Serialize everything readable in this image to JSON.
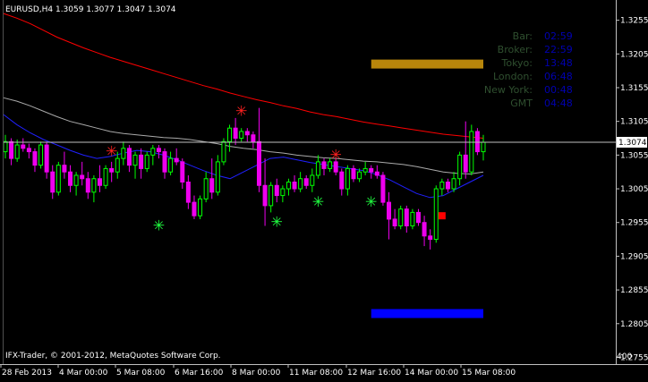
{
  "symbol_header": "EURUSD,H4  1.3059 1.3077 1.3047 1.3074",
  "copyright": "IFX-Trader, © 2001-2012, MetaQuotes Software Corp.",
  "corner_label": "400",
  "info_panel": {
    "rows": [
      {
        "label": "Bar:",
        "value": "02:59"
      },
      {
        "label": "Broker:",
        "value": "22:59"
      },
      {
        "label": "Tokyo:",
        "value": "13:48"
      },
      {
        "label": "London:",
        "value": "06:48"
      },
      {
        "label": "New York:",
        "value": "00:48"
      },
      {
        "label": "GMT",
        "value": "04:48"
      }
    ]
  },
  "colors": {
    "background": "#000000",
    "axis": "#c0c0c0",
    "text": "#ffffff",
    "bull": "#00ff00",
    "bear": "#ee00ee",
    "ma_red": "#ff0000",
    "ma_gray": "#aaaaaa",
    "ma_blue": "#2020ff",
    "panel_label": "#2f4f2f",
    "panel_value": "#0000b0",
    "gold_bar": "#b8860b",
    "blue_bar": "#0000ff",
    "star_red": "#ff2020",
    "star_green": "#20ff40",
    "marker_red": "#ff0000"
  },
  "chart_data": {
    "type": "candlestick",
    "current_price": "1.3074",
    "y_ticks": [
      "1.3255",
      "1.3205",
      "1.3155",
      "1.3105",
      "1.3055",
      "1.3005",
      "1.2955",
      "1.2905",
      "1.2855",
      "1.2805",
      "1.2755"
    ],
    "x_ticks": [
      "28 Feb 2013",
      "4 Mar 00:00",
      "5 Mar 08:00",
      "6 Mar 16:00",
      "8 Mar 00:00",
      "11 Mar 08:00",
      "12 Mar 16:00",
      "14 Mar 00:00",
      "15 Mar 08:00"
    ],
    "ylim": [
      1.2745,
      1.3285
    ],
    "candles": [
      [
        1.306,
        1.3085,
        1.305,
        1.3075
      ],
      [
        1.3075,
        1.308,
        1.304,
        1.305
      ],
      [
        1.305,
        1.3078,
        1.3045,
        1.307
      ],
      [
        1.307,
        1.308,
        1.306,
        1.3065
      ],
      [
        1.3065,
        1.3072,
        1.305,
        1.306
      ],
      [
        1.306,
        1.3065,
        1.303,
        1.304
      ],
      [
        1.304,
        1.3075,
        1.3035,
        1.307
      ],
      [
        1.307,
        1.3075,
        1.302,
        1.303
      ],
      [
        1.303,
        1.304,
        1.299,
        1.3
      ],
      [
        1.3,
        1.3045,
        1.2995,
        1.304
      ],
      [
        1.304,
        1.306,
        1.302,
        1.303
      ],
      [
        1.303,
        1.304,
        1.3,
        1.301
      ],
      [
        1.301,
        1.303,
        1.2995,
        1.3025
      ],
      [
        1.3025,
        1.3045,
        1.301,
        1.302
      ],
      [
        1.302,
        1.303,
        1.299,
        1.3
      ],
      [
        1.3,
        1.3025,
        1.2985,
        1.302
      ],
      [
        1.302,
        1.304,
        1.3,
        1.301
      ],
      [
        1.301,
        1.304,
        1.3005,
        1.3035
      ],
      [
        1.3035,
        1.3045,
        1.3015,
        1.303
      ],
      [
        1.303,
        1.306,
        1.302,
        1.305
      ],
      [
        1.305,
        1.3075,
        1.304,
        1.3065
      ],
      [
        1.3065,
        1.307,
        1.303,
        1.304
      ],
      [
        1.304,
        1.306,
        1.302,
        1.3055
      ],
      [
        1.3055,
        1.3065,
        1.302,
        1.3035
      ],
      [
        1.3035,
        1.306,
        1.303,
        1.3055
      ],
      [
        1.3055,
        1.307,
        1.304,
        1.3065
      ],
      [
        1.3065,
        1.307,
        1.305,
        1.306
      ],
      [
        1.306,
        1.3065,
        1.302,
        1.303
      ],
      [
        1.303,
        1.306,
        1.3025,
        1.305
      ],
      [
        1.305,
        1.3065,
        1.304,
        1.3045
      ],
      [
        1.3045,
        1.305,
        1.3005,
        1.3015
      ],
      [
        1.3015,
        1.3025,
        1.2975,
        1.2985
      ],
      [
        1.2985,
        1.2995,
        1.296,
        1.2965
      ],
      [
        1.2965,
        1.2995,
        1.296,
        1.299
      ],
      [
        1.299,
        1.303,
        1.2985,
        1.302
      ],
      [
        1.302,
        1.305,
        1.299,
        1.3
      ],
      [
        1.3,
        1.3055,
        1.2995,
        1.3045
      ],
      [
        1.3045,
        1.308,
        1.304,
        1.3075
      ],
      [
        1.3075,
        1.31,
        1.306,
        1.3095
      ],
      [
        1.3095,
        1.311,
        1.307,
        1.308
      ],
      [
        1.308,
        1.3095,
        1.3075,
        1.309
      ],
      [
        1.309,
        1.3095,
        1.3075,
        1.3085
      ],
      [
        1.3085,
        1.309,
        1.3065,
        1.3075
      ],
      [
        1.3075,
        1.3125,
        1.3,
        1.301
      ],
      [
        1.301,
        1.305,
        1.295,
        1.298
      ],
      [
        1.298,
        1.3015,
        1.297,
        1.301
      ],
      [
        1.301,
        1.302,
        1.2985,
        1.2995
      ],
      [
        1.2995,
        1.301,
        1.2985,
        1.3005
      ],
      [
        1.3005,
        1.302,
        1.2995,
        1.3015
      ],
      [
        1.3015,
        1.3025,
        1.3,
        1.3005
      ],
      [
        1.3005,
        1.303,
        1.3,
        1.302
      ],
      [
        1.302,
        1.3025,
        1.3005,
        1.301
      ],
      [
        1.301,
        1.3035,
        1.3,
        1.3025
      ],
      [
        1.3025,
        1.3055,
        1.302,
        1.3045
      ],
      [
        1.3045,
        1.305,
        1.3025,
        1.3035
      ],
      [
        1.3035,
        1.305,
        1.303,
        1.3045
      ],
      [
        1.3045,
        1.305,
        1.3025,
        1.303
      ],
      [
        1.303,
        1.3035,
        1.2995,
        1.3005
      ],
      [
        1.3005,
        1.304,
        1.2995,
        1.3035
      ],
      [
        1.3035,
        1.304,
        1.3015,
        1.302
      ],
      [
        1.302,
        1.3035,
        1.3015,
        1.303
      ],
      [
        1.303,
        1.3045,
        1.3025,
        1.3035
      ],
      [
        1.3035,
        1.304,
        1.302,
        1.303
      ],
      [
        1.303,
        1.304,
        1.302,
        1.3025
      ],
      [
        1.3025,
        1.303,
        1.298,
        1.2985
      ],
      [
        1.2985,
        1.3,
        1.293,
        1.296
      ],
      [
        1.296,
        1.2975,
        1.2945,
        1.295
      ],
      [
        1.295,
        1.298,
        1.2945,
        1.2975
      ],
      [
        1.2975,
        1.298,
        1.294,
        1.295
      ],
      [
        1.295,
        1.2975,
        1.2945,
        1.297
      ],
      [
        1.297,
        1.2975,
        1.295,
        1.2955
      ],
      [
        1.2955,
        1.2965,
        1.292,
        1.2935
      ],
      [
        1.2935,
        1.2945,
        1.2915,
        1.293
      ],
      [
        1.293,
        1.301,
        1.2925,
        1.3005
      ],
      [
        1.3005,
        1.302,
        1.2995,
        1.3015
      ],
      [
        1.3015,
        1.302,
        1.3,
        1.3005
      ],
      [
        1.3005,
        1.303,
        1.3,
        1.302
      ],
      [
        1.302,
        1.306,
        1.301,
        1.3055
      ],
      [
        1.3055,
        1.3105,
        1.302,
        1.303
      ],
      [
        1.303,
        1.31,
        1.3025,
        1.309
      ],
      [
        1.309,
        1.3095,
        1.3055,
        1.306
      ],
      [
        1.306,
        1.3085,
        1.3047,
        1.3074
      ]
    ],
    "ma_red": [
      1.3265,
      1.3258,
      1.325,
      1.324,
      1.323,
      1.3222,
      1.3214,
      1.3207,
      1.32,
      1.3194,
      1.3188,
      1.3182,
      1.3176,
      1.317,
      1.3164,
      1.3158,
      1.3153,
      1.3147,
      1.3142,
      1.3137,
      1.3133,
      1.3128,
      1.3124,
      1.3119,
      1.3115,
      1.3112,
      1.3108,
      1.3104,
      1.3101,
      1.3098,
      1.3095,
      1.3092,
      1.3089,
      1.3086,
      1.3084,
      1.3082,
      1.308
    ],
    "ma_gray": [
      1.314,
      1.3135,
      1.3128,
      1.312,
      1.3112,
      1.3105,
      1.31,
      1.3095,
      1.309,
      1.3087,
      1.3085,
      1.3083,
      1.3081,
      1.308,
      1.3078,
      1.3075,
      1.3072,
      1.3068,
      1.3065,
      1.3063,
      1.306,
      1.3058,
      1.3055,
      1.3053,
      1.3051,
      1.305,
      1.3048,
      1.3046,
      1.3045,
      1.3043,
      1.3041,
      1.3038,
      1.3034,
      1.303,
      1.3028,
      1.3027,
      1.303
    ],
    "ma_blue": [
      1.3115,
      1.31,
      1.3088,
      1.3078,
      1.307,
      1.3062,
      1.3055,
      1.305,
      1.3053,
      1.3058,
      1.3062,
      1.306,
      1.3055,
      1.3048,
      1.304,
      1.3032,
      1.3025,
      1.302,
      1.303,
      1.304,
      1.305,
      1.3052,
      1.3048,
      1.3044,
      1.3041,
      1.3038,
      1.3035,
      1.3032,
      1.3026,
      1.3018,
      1.3008,
      1.2998,
      1.2992,
      1.2995,
      1.3005,
      1.3015,
      1.3025
    ],
    "stars": [
      {
        "index": 18,
        "price": 1.306,
        "color": "red"
      },
      {
        "index": 26,
        "price": 1.295,
        "color": "green"
      },
      {
        "index": 40,
        "price": 1.312,
        "color": "red"
      },
      {
        "index": 46,
        "price": 1.2955,
        "color": "green"
      },
      {
        "index": 53,
        "price": 1.2985,
        "color": "green"
      },
      {
        "index": 56,
        "price": 1.3055,
        "color": "red"
      },
      {
        "index": 62,
        "price": 1.2985,
        "color": "green"
      }
    ],
    "marker_square": {
      "index": 74,
      "price": 1.2965
    },
    "gold_level": 1.319,
    "blue_level": 1.282
  }
}
